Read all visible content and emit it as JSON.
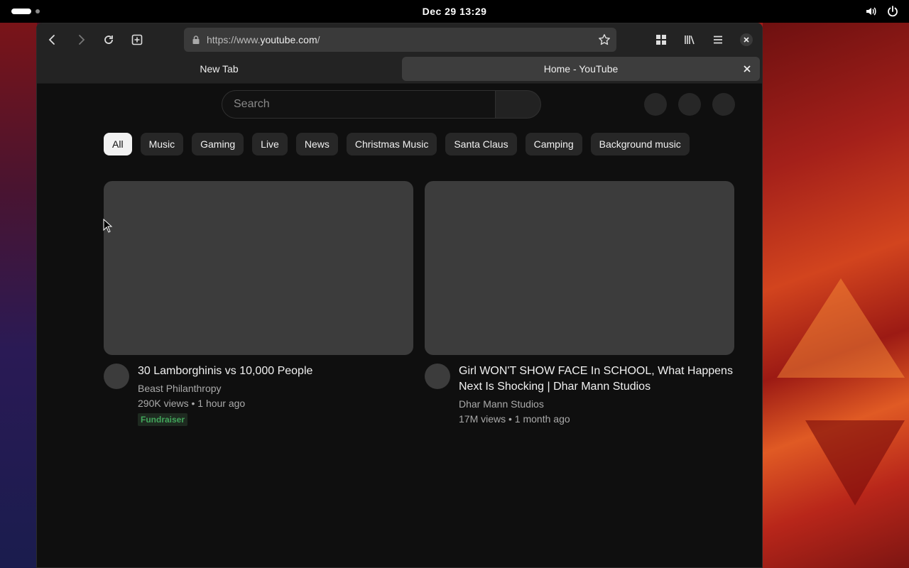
{
  "topbar": {
    "clock": "Dec 29  13:29"
  },
  "browser": {
    "url_scheme": "https://www.",
    "url_host": "youtube.com",
    "url_path": "/",
    "tabs": [
      {
        "label": "New Tab",
        "active": false
      },
      {
        "label": "Home - YouTube",
        "active": true
      }
    ]
  },
  "youtube": {
    "search": {
      "placeholder": "Search"
    },
    "chips": [
      "All",
      "Music",
      "Gaming",
      "Live",
      "News",
      "Christmas Music",
      "Santa Claus",
      "Camping",
      "Background music"
    ],
    "videos": [
      {
        "title": "30 Lamborghinis vs 10,000 People",
        "channel": "Beast Philanthropy",
        "stats": "290K views • 1 hour ago",
        "badge": "Fundraiser"
      },
      {
        "title": "Girl WON'T SHOW FACE In SCHOOL, What Happens Next Is Shocking | Dhar Mann Studios",
        "channel": "Dhar Mann Studios",
        "stats": "17M views • 1 month ago"
      }
    ]
  },
  "colors": {
    "accent_badge": "#41a55a",
    "page_bg": "#0f0f0f",
    "chip_bg": "#272727"
  }
}
